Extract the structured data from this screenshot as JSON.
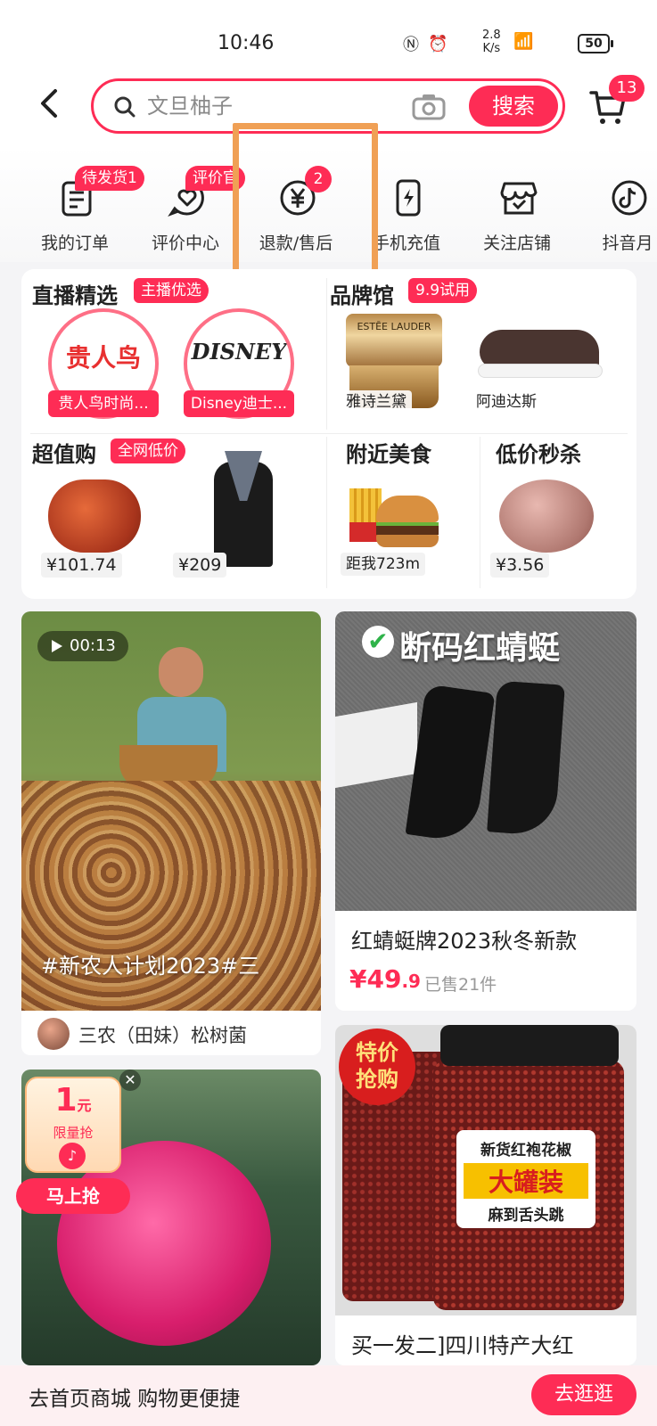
{
  "status": {
    "time": "10:46",
    "speed": "2.8\nK/s",
    "speed_top": "2.8",
    "speed_bottom": "K/s",
    "battery": "50"
  },
  "search": {
    "placeholder": "文旦柚子",
    "button_label": "搜索",
    "cart_count": "13"
  },
  "quick": [
    {
      "label": "我的订单",
      "badge": "待发货1",
      "icon": "order-list-icon"
    },
    {
      "label": "评价中心",
      "badge": "评价官",
      "icon": "heart-chat-icon"
    },
    {
      "label": "退款/售后",
      "badge": "2",
      "icon": "yen-refund-icon"
    },
    {
      "label": "手机充值",
      "badge": "",
      "icon": "phone-charge-icon"
    },
    {
      "label": "关注店铺",
      "badge": "",
      "icon": "store-icon"
    },
    {
      "label": "抖音月",
      "badge": "",
      "icon": "douyin-monthly-icon"
    }
  ],
  "promo": {
    "live": {
      "title": "直播精选",
      "tag": "主播优选",
      "items": [
        {
          "label": "贵人鸟时尚...",
          "logo": "贵人鸟"
        },
        {
          "label": "Disney迪士...",
          "logo": "DISNEY"
        }
      ]
    },
    "brand": {
      "title": "品牌馆",
      "tag": "9.9试用",
      "items": [
        {
          "label": "雅诗兰黛",
          "logo": "ESTĒE LAUDER"
        },
        {
          "label": "阿迪达斯"
        }
      ]
    },
    "value": {
      "title": "超值购",
      "tag": "全网低价",
      "items": [
        {
          "price": "¥101.74"
        },
        {
          "price": "¥209"
        }
      ]
    },
    "food": {
      "title": "附近美食",
      "distance": "距我723m"
    },
    "flash": {
      "title": "低价秒杀",
      "price": "¥3.56"
    }
  },
  "feed": {
    "video": {
      "duration": "00:13",
      "caption": "#新农人计划2023#三",
      "author": "三农（田妹）松树菌"
    },
    "product1": {
      "banner": "断码红蜻蜓",
      "title": "红蜻蜓牌2023秋冬新款",
      "price_main": "¥49",
      "price_decimal": ".9",
      "sold": "已售21件"
    },
    "product2": {
      "corner": "特价\n抢购",
      "corner_line1": "特价",
      "corner_line2": "抢购",
      "label_top": "新货红袍花椒",
      "label_mid": "大罐装",
      "label_bottom": "麻到舌头跳",
      "title": "买一发二]四川特产大红"
    }
  },
  "coupon": {
    "amount": "1",
    "unit": "元",
    "limit": "限量抢",
    "grab": "马上抢"
  },
  "bottom_bar": {
    "text": "去首页商城 购物更便捷",
    "button": "去逛逛"
  },
  "colors": {
    "accent": "#fe2c55",
    "highlight": "#f0a055"
  }
}
